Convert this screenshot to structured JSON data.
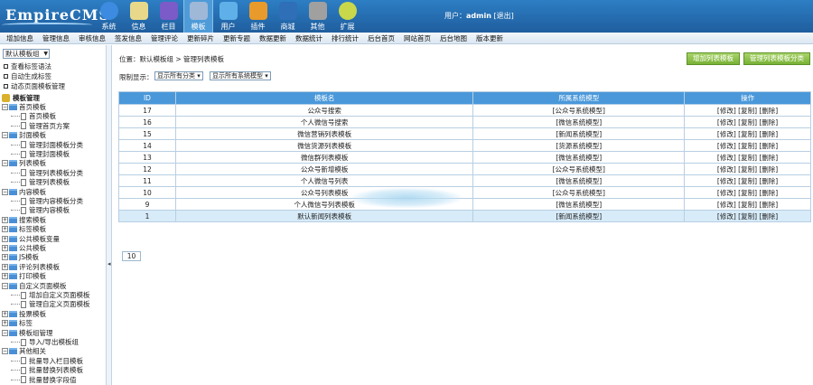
{
  "header": {
    "logo": "EmpireCMS",
    "nav": [
      {
        "label": "系统",
        "icon": "globe-icon",
        "color": "#3c8be0"
      },
      {
        "label": "信息",
        "icon": "pencil-icon",
        "color": "#e8d98a"
      },
      {
        "label": "栏目",
        "icon": "folder-icon",
        "color": "#7b5bc8"
      },
      {
        "label": "模板",
        "icon": "template-icon",
        "color": "#9fb8d8"
      },
      {
        "label": "用户",
        "icon": "user-icon",
        "color": "#5fb0e8"
      },
      {
        "label": "插件",
        "icon": "plugin-icon",
        "color": "#e89a2a"
      },
      {
        "label": "商城",
        "icon": "shop-icon",
        "color": "#2e6fb8"
      },
      {
        "label": "其他",
        "icon": "gear-icon",
        "color": "#a0a0a0"
      },
      {
        "label": "扩展",
        "icon": "plus-icon",
        "color": "#c8d84a"
      }
    ],
    "user_prefix": "用户：",
    "username": "admin",
    "logout": "[退出]"
  },
  "menubar": [
    "增加信息",
    "管理信息",
    "审核信息",
    "签发信息",
    "管理评论",
    "更新碎片",
    "更新专题",
    "数据更新",
    "数据统计",
    "排行统计",
    "后台首页",
    "网站首页",
    "后台地图",
    "版本更新"
  ],
  "sidebar": {
    "group_select": "默认模板组",
    "links": [
      "查看标签语法",
      "自动生成标签",
      "动态页面模板管理"
    ],
    "tree_root": "模板管理",
    "tree": [
      {
        "label": "首页模板",
        "level": 0,
        "kind": "folder",
        "open": true
      },
      {
        "label": "首页模板",
        "level": 1,
        "kind": "page"
      },
      {
        "label": "管理首页方案",
        "level": 1,
        "kind": "page"
      },
      {
        "label": "封面模板",
        "level": 0,
        "kind": "folder",
        "open": true
      },
      {
        "label": "管理封面模板分类",
        "level": 1,
        "kind": "page"
      },
      {
        "label": "管理封面模板",
        "level": 1,
        "kind": "page"
      },
      {
        "label": "列表模板",
        "level": 0,
        "kind": "folder",
        "open": true
      },
      {
        "label": "管理列表模板分类",
        "level": 1,
        "kind": "page"
      },
      {
        "label": "管理列表模板",
        "level": 1,
        "kind": "page"
      },
      {
        "label": "内容模板",
        "level": 0,
        "kind": "folder",
        "open": true
      },
      {
        "label": "管理内容模板分类",
        "level": 1,
        "kind": "page"
      },
      {
        "label": "管理内容模板",
        "level": 1,
        "kind": "page"
      },
      {
        "label": "搜索模板",
        "level": 0,
        "kind": "folder",
        "open": false
      },
      {
        "label": "标签模板",
        "level": 0,
        "kind": "folder",
        "open": false
      },
      {
        "label": "公共模板变量",
        "level": 0,
        "kind": "folder",
        "open": false
      },
      {
        "label": "公共模板",
        "level": 0,
        "kind": "folder",
        "open": false
      },
      {
        "label": "JS模板",
        "level": 0,
        "kind": "folder",
        "open": false
      },
      {
        "label": "评论列表模板",
        "level": 0,
        "kind": "folder",
        "open": false
      },
      {
        "label": "打印模板",
        "level": 0,
        "kind": "folder",
        "open": false
      },
      {
        "label": "自定义页面模板",
        "level": 0,
        "kind": "folder",
        "open": true
      },
      {
        "label": "增加自定义页面模板",
        "level": 1,
        "kind": "page"
      },
      {
        "label": "管理自定义页面模板",
        "level": 1,
        "kind": "page"
      },
      {
        "label": "投票模板",
        "level": 0,
        "kind": "folder",
        "open": false
      },
      {
        "label": "标签",
        "level": 0,
        "kind": "folder",
        "open": false
      },
      {
        "label": "模板组管理",
        "level": 0,
        "kind": "folder",
        "open": true
      },
      {
        "label": "导入/导出模板组",
        "level": 1,
        "kind": "page"
      },
      {
        "label": "其他相关",
        "level": 0,
        "kind": "folder",
        "open": true
      },
      {
        "label": "批量导入栏目模板",
        "level": 1,
        "kind": "page"
      },
      {
        "label": "批量替换列表模板",
        "level": 1,
        "kind": "page"
      },
      {
        "label": "批量替换字段值",
        "level": 1,
        "kind": "page"
      }
    ]
  },
  "main": {
    "breadcrumb": "位置：默认模板组 > 管理列表模板",
    "btn_add": "增加列表模板",
    "btn_manage_cat": "管理列表模板分类",
    "filter_label": "限制显示：",
    "filter_cat": "显示所有分类 ▾",
    "filter_model": "显示所有系统模型 ▾",
    "columns": [
      "ID",
      "模板名",
      "所属系统模型",
      "操作"
    ],
    "rows": [
      {
        "id": "17",
        "name": "公众号搜索",
        "model": "[公众号系统模型]",
        "ops": "[修改] [复制] [删除]"
      },
      {
        "id": "16",
        "name": "个人微信号搜索",
        "model": "[微信系统模型]",
        "ops": "[修改] [复制] [删除]"
      },
      {
        "id": "15",
        "name": "微信营销列表模板",
        "model": "[新闻系统模型]",
        "ops": "[修改] [复制] [删除]"
      },
      {
        "id": "14",
        "name": "微信货源列表模板",
        "model": "[货源系统模型]",
        "ops": "[修改] [复制] [删除]"
      },
      {
        "id": "13",
        "name": "微信群列表模板",
        "model": "[微信系统模型]",
        "ops": "[修改] [复制] [删除]"
      },
      {
        "id": "12",
        "name": "公众号新增模板",
        "model": "[公众号系统模型]",
        "ops": "[修改] [复制] [删除]"
      },
      {
        "id": "11",
        "name": "个人微信号列表",
        "model": "[微信系统模型]",
        "ops": "[修改] [复制] [删除]"
      },
      {
        "id": "10",
        "name": "公众号列表模板",
        "model": "[公众号系统模型]",
        "ops": "[修改] [复制] [删除]"
      },
      {
        "id": "9",
        "name": "个人微信号列表模板",
        "model": "[微信系统模型]",
        "ops": "[修改] [复制] [删除]"
      },
      {
        "id": "1",
        "name": "默认新闻列表模板",
        "model": "[新闻系统模型]",
        "ops": "[修改] [复制] [删除]"
      }
    ],
    "page_number": "10"
  }
}
